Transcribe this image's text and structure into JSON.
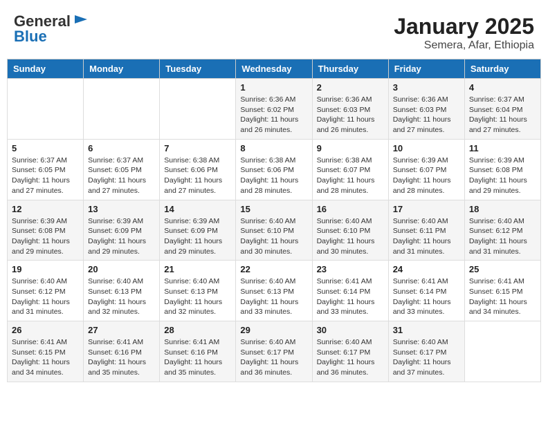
{
  "header": {
    "logo_general": "General",
    "logo_blue": "Blue",
    "title": "January 2025",
    "subtitle": "Semera, Afar, Ethiopia"
  },
  "days_of_week": [
    "Sunday",
    "Monday",
    "Tuesday",
    "Wednesday",
    "Thursday",
    "Friday",
    "Saturday"
  ],
  "weeks": [
    [
      {
        "day": "",
        "info": ""
      },
      {
        "day": "",
        "info": ""
      },
      {
        "day": "",
        "info": ""
      },
      {
        "day": "1",
        "info": "Sunrise: 6:36 AM\nSunset: 6:02 PM\nDaylight: 11 hours and 26 minutes."
      },
      {
        "day": "2",
        "info": "Sunrise: 6:36 AM\nSunset: 6:03 PM\nDaylight: 11 hours and 26 minutes."
      },
      {
        "day": "3",
        "info": "Sunrise: 6:36 AM\nSunset: 6:03 PM\nDaylight: 11 hours and 27 minutes."
      },
      {
        "day": "4",
        "info": "Sunrise: 6:37 AM\nSunset: 6:04 PM\nDaylight: 11 hours and 27 minutes."
      }
    ],
    [
      {
        "day": "5",
        "info": "Sunrise: 6:37 AM\nSunset: 6:05 PM\nDaylight: 11 hours and 27 minutes."
      },
      {
        "day": "6",
        "info": "Sunrise: 6:37 AM\nSunset: 6:05 PM\nDaylight: 11 hours and 27 minutes."
      },
      {
        "day": "7",
        "info": "Sunrise: 6:38 AM\nSunset: 6:06 PM\nDaylight: 11 hours and 27 minutes."
      },
      {
        "day": "8",
        "info": "Sunrise: 6:38 AM\nSunset: 6:06 PM\nDaylight: 11 hours and 28 minutes."
      },
      {
        "day": "9",
        "info": "Sunrise: 6:38 AM\nSunset: 6:07 PM\nDaylight: 11 hours and 28 minutes."
      },
      {
        "day": "10",
        "info": "Sunrise: 6:39 AM\nSunset: 6:07 PM\nDaylight: 11 hours and 28 minutes."
      },
      {
        "day": "11",
        "info": "Sunrise: 6:39 AM\nSunset: 6:08 PM\nDaylight: 11 hours and 29 minutes."
      }
    ],
    [
      {
        "day": "12",
        "info": "Sunrise: 6:39 AM\nSunset: 6:08 PM\nDaylight: 11 hours and 29 minutes."
      },
      {
        "day": "13",
        "info": "Sunrise: 6:39 AM\nSunset: 6:09 PM\nDaylight: 11 hours and 29 minutes."
      },
      {
        "day": "14",
        "info": "Sunrise: 6:39 AM\nSunset: 6:09 PM\nDaylight: 11 hours and 29 minutes."
      },
      {
        "day": "15",
        "info": "Sunrise: 6:40 AM\nSunset: 6:10 PM\nDaylight: 11 hours and 30 minutes."
      },
      {
        "day": "16",
        "info": "Sunrise: 6:40 AM\nSunset: 6:10 PM\nDaylight: 11 hours and 30 minutes."
      },
      {
        "day": "17",
        "info": "Sunrise: 6:40 AM\nSunset: 6:11 PM\nDaylight: 11 hours and 31 minutes."
      },
      {
        "day": "18",
        "info": "Sunrise: 6:40 AM\nSunset: 6:12 PM\nDaylight: 11 hours and 31 minutes."
      }
    ],
    [
      {
        "day": "19",
        "info": "Sunrise: 6:40 AM\nSunset: 6:12 PM\nDaylight: 11 hours and 31 minutes."
      },
      {
        "day": "20",
        "info": "Sunrise: 6:40 AM\nSunset: 6:13 PM\nDaylight: 11 hours and 32 minutes."
      },
      {
        "day": "21",
        "info": "Sunrise: 6:40 AM\nSunset: 6:13 PM\nDaylight: 11 hours and 32 minutes."
      },
      {
        "day": "22",
        "info": "Sunrise: 6:40 AM\nSunset: 6:13 PM\nDaylight: 11 hours and 33 minutes."
      },
      {
        "day": "23",
        "info": "Sunrise: 6:41 AM\nSunset: 6:14 PM\nDaylight: 11 hours and 33 minutes."
      },
      {
        "day": "24",
        "info": "Sunrise: 6:41 AM\nSunset: 6:14 PM\nDaylight: 11 hours and 33 minutes."
      },
      {
        "day": "25",
        "info": "Sunrise: 6:41 AM\nSunset: 6:15 PM\nDaylight: 11 hours and 34 minutes."
      }
    ],
    [
      {
        "day": "26",
        "info": "Sunrise: 6:41 AM\nSunset: 6:15 PM\nDaylight: 11 hours and 34 minutes."
      },
      {
        "day": "27",
        "info": "Sunrise: 6:41 AM\nSunset: 6:16 PM\nDaylight: 11 hours and 35 minutes."
      },
      {
        "day": "28",
        "info": "Sunrise: 6:41 AM\nSunset: 6:16 PM\nDaylight: 11 hours and 35 minutes."
      },
      {
        "day": "29",
        "info": "Sunrise: 6:40 AM\nSunset: 6:17 PM\nDaylight: 11 hours and 36 minutes."
      },
      {
        "day": "30",
        "info": "Sunrise: 6:40 AM\nSunset: 6:17 PM\nDaylight: 11 hours and 36 minutes."
      },
      {
        "day": "31",
        "info": "Sunrise: 6:40 AM\nSunset: 6:17 PM\nDaylight: 11 hours and 37 minutes."
      },
      {
        "day": "",
        "info": ""
      }
    ]
  ]
}
